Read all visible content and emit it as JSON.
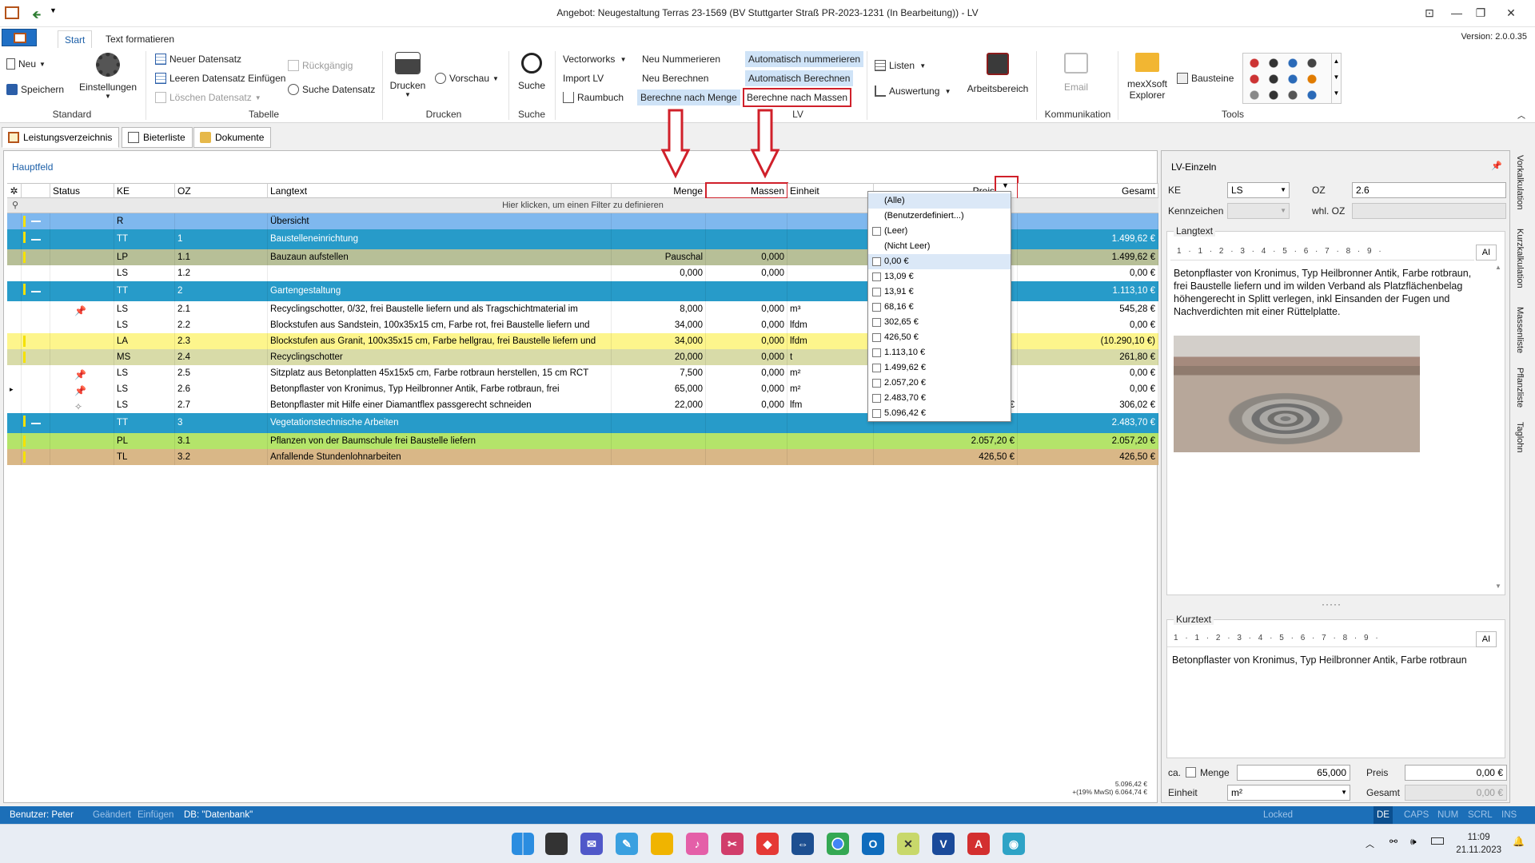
{
  "window": {
    "title": "Angebot: Neugestaltung Terras 23-1569 (BV Stuttgarter Straß PR-2023-1231 (In Bearbeitung)) - LV",
    "version": "Version: 2.0.0.35"
  },
  "ribbon": {
    "tabs": [
      "Start",
      "Text formatieren"
    ],
    "standard": {
      "new": "Neu",
      "save": "Speichern",
      "settings": "Einstellungen",
      "label": "Standard"
    },
    "tabelle": {
      "new_record": "Neuer Datensatz",
      "insert_empty": "Leeren Datensatz Einfügen",
      "delete": "Löschen Datensatz",
      "undo": "Rückgängig",
      "search_record": "Suche Datensatz",
      "label": "Tabelle"
    },
    "drucken": {
      "print": "Drucken",
      "preview": "Vorschau",
      "label": "Drucken"
    },
    "suche": {
      "search": "Suche",
      "label": "Suche"
    },
    "lv": {
      "vectorworks": "Vectorworks",
      "import": "Import LV",
      "raumbuch": "Raumbuch",
      "renumber": "Neu Nummerieren",
      "recalc": "Neu Berechnen",
      "calc_menge": "Berechne nach Menge",
      "auto_number": "Automatisch nummerieren",
      "auto_calc": "Automatisch Berechnen",
      "calc_massen": "Berechne nach Massen",
      "label": "LV"
    },
    "listen": {
      "listen": "Listen",
      "auswertung": "Auswertung"
    },
    "arbeitsbereich": "Arbeitsbereich",
    "kommunikation": {
      "email": "Email",
      "label": "Kommunikation"
    },
    "explorer": "mexXsoft Explorer",
    "bausteine": "Bausteine",
    "tools_label": "Tools"
  },
  "doc_tabs": [
    "Leistungsverzeichnis",
    "Bieterliste",
    "Dokumente"
  ],
  "grid": {
    "section_title": "Hauptfeld",
    "columns": [
      "Status",
      "KE",
      "OZ",
      "Langtext",
      "Menge",
      "Massen",
      "Einheit",
      "Preis",
      "Gesamt"
    ],
    "filter_hint": "Hier klicken, um einen Filter zu definieren",
    "rows": [
      {
        "ke": "R",
        "oz": "",
        "langtext": "Übersicht",
        "menge": "",
        "massen": "",
        "einheit": "",
        "preis": "",
        "gesamt": "",
        "status": ""
      },
      {
        "ke": "TT",
        "oz": "1",
        "langtext": "Baustelleneinrichtung",
        "menge": "",
        "massen": "",
        "einheit": "",
        "preis": "",
        "gesamt": "1.499,62 €",
        "status": ""
      },
      {
        "ke": "LP",
        "oz": "1.1",
        "langtext": "Bauzaun aufstellen",
        "menge": "Pauschal",
        "massen": "0,000",
        "einheit": "",
        "preis": "",
        "gesamt": "1.499,62 €",
        "status": ""
      },
      {
        "ke": "LS",
        "oz": "1.2",
        "langtext": "",
        "menge": "0,000",
        "massen": "0,000",
        "einheit": "",
        "preis": "",
        "gesamt": "0,00 €",
        "status": ""
      },
      {
        "ke": "TT",
        "oz": "2",
        "langtext": "Gartengestaltung",
        "menge": "",
        "massen": "",
        "einheit": "",
        "preis": "",
        "gesamt": "1.113,10 €",
        "status": ""
      },
      {
        "ke": "LS",
        "oz": "2.1",
        "langtext": "Recyclingschotter, 0/32, frei Baustelle liefern und als Tragschichtmaterial im",
        "menge": "8,000",
        "massen": "0,000",
        "einheit": "m³",
        "preis": "",
        "gesamt": "545,28 €",
        "status": "pin-blue"
      },
      {
        "ke": "LS",
        "oz": "2.2",
        "langtext": "Blockstufen aus Sandstein, 100x35x15 cm, Farbe rot, frei Baustelle liefern und",
        "menge": "34,000",
        "massen": "0,000",
        "einheit": "lfdm",
        "preis": "",
        "gesamt": "0,00 €",
        "status": ""
      },
      {
        "ke": "LA",
        "oz": "2.3",
        "langtext": "Blockstufen aus Granit, 100x35x15 cm, Farbe hellgrau, frei Baustelle liefern und",
        "menge": "34,000",
        "massen": "0,000",
        "einheit": "lfdm",
        "preis": "",
        "gesamt": "(10.290,10 €)",
        "status": ""
      },
      {
        "ke": "MS",
        "oz": "2.4",
        "langtext": "Recyclingschotter",
        "menge": "20,000",
        "massen": "0,000",
        "einheit": "t",
        "preis": "",
        "gesamt": "261,80 €",
        "status": ""
      },
      {
        "ke": "LS",
        "oz": "2.5",
        "langtext": "Sitzplatz aus Betonplatten 45x15x5 cm, Farbe rotbraun herstellen, 15 cm RCT",
        "menge": "7,500",
        "massen": "0,000",
        "einheit": "m²",
        "preis": "",
        "gesamt": "0,00 €",
        "status": "pin-blue"
      },
      {
        "ke": "LS",
        "oz": "2.6",
        "langtext": "Betonpflaster von Kronimus, Typ Heilbronner Antik, Farbe rotbraun, frei",
        "menge": "65,000",
        "massen": "0,000",
        "einheit": "m²",
        "preis": "",
        "gesamt": "0,00 €",
        "status": "pin-red"
      },
      {
        "ke": "LS",
        "oz": "2.7",
        "langtext": "Betonpflaster mit Hilfe einer Diamantflex passgerecht schneiden",
        "menge": "22,000",
        "massen": "0,000",
        "einheit": "lfm",
        "preis": "13,91 €",
        "gesamt": "306,02 €",
        "status": "pin-outline"
      },
      {
        "ke": "TT",
        "oz": "3",
        "langtext": "Vegetationstechnische Arbeiten",
        "menge": "",
        "massen": "",
        "einheit": "",
        "preis": "",
        "gesamt": "2.483,70 €",
        "status": ""
      },
      {
        "ke": "PL",
        "oz": "3.1",
        "langtext": "Pflanzen von der Baumschule frei Baustelle liefern",
        "menge": "",
        "massen": "",
        "einheit": "",
        "preis": "2.057,20 €",
        "gesamt": "2.057,20 €",
        "status": ""
      },
      {
        "ke": "TL",
        "oz": "3.2",
        "langtext": "Anfallende Stundenlohnarbeiten",
        "menge": "",
        "massen": "",
        "einheit": "",
        "preis": "426,50 €",
        "gesamt": "426,50 €",
        "status": ""
      }
    ],
    "sum_total": "5.096,42 €",
    "sum_vat": "+(19% MwSt) 6.064,74 €"
  },
  "filter_dropdown": {
    "items": [
      "(Alle)",
      "(Benutzerdefiniert...)",
      "(Leer)",
      "(Nicht Leer)",
      "0,00 €",
      "13,09 €",
      "13,91 €",
      "68,16 €",
      "302,65 €",
      "426,50 €",
      "1.113,10 €",
      "1.499,62 €",
      "2.057,20 €",
      "2.483,70 €",
      "5.096,42 €"
    ]
  },
  "right_panel": {
    "title": "LV-Einzeln",
    "ke_label": "KE",
    "ke_value": "LS",
    "oz_label": "OZ",
    "oz_value": "2.6",
    "kennzeichen_label": "Kennzeichen",
    "whl_oz_label": "whl. OZ",
    "langtext_label": "Langtext",
    "langtext": "Betonpflaster von Kronimus, Typ Heilbronner Antik, Farbe rotbraun, frei Baustelle liefern und im wilden Verband als Platzflächenbelag höhengerecht in Splitt verlegen, inkl Einsanden der Fugen und Nachverdichten mit einer Rüttelplatte.",
    "kurztext_label": "Kurztext",
    "kurztext": "Betonpflaster von Kronimus, Typ Heilbronner Antik, Farbe rotbraun",
    "ca_label": "ca.",
    "menge_label": "Menge",
    "menge_value": "65,000",
    "preis_label": "Preis",
    "preis_value": "0,00 €",
    "einheit_label": "Einheit",
    "einheit_value": "m²",
    "gesamt_label": "Gesamt",
    "gesamt_value": "0,00 €",
    "ruler": "1 · 1 · 2 · 3 · 4 · 5 · 6 · 7 · 8 · 9 ·",
    "ai_label": "AI"
  },
  "side_tabs": [
    "Vorkalkulation",
    "Kurzkalkulation",
    "Massenliste",
    "Pflanzliste",
    "Taglohn"
  ],
  "statusbar": {
    "user": "Benutzer: Peter",
    "changed": "Geändert",
    "insert": "Einfügen",
    "db": "DB: \"Datenbank\"",
    "locked": "Locked",
    "lang": "DE",
    "caps": "CAPS",
    "num": "NUM",
    "scrl": "SCRL",
    "ins": "INS"
  },
  "taskbar": {
    "time": "11:09",
    "date": "21.11.2023"
  },
  "colors": {
    "accent": "#1c6fb8",
    "tt_row": "#279bc9",
    "highlight_red": "#d0202a"
  }
}
